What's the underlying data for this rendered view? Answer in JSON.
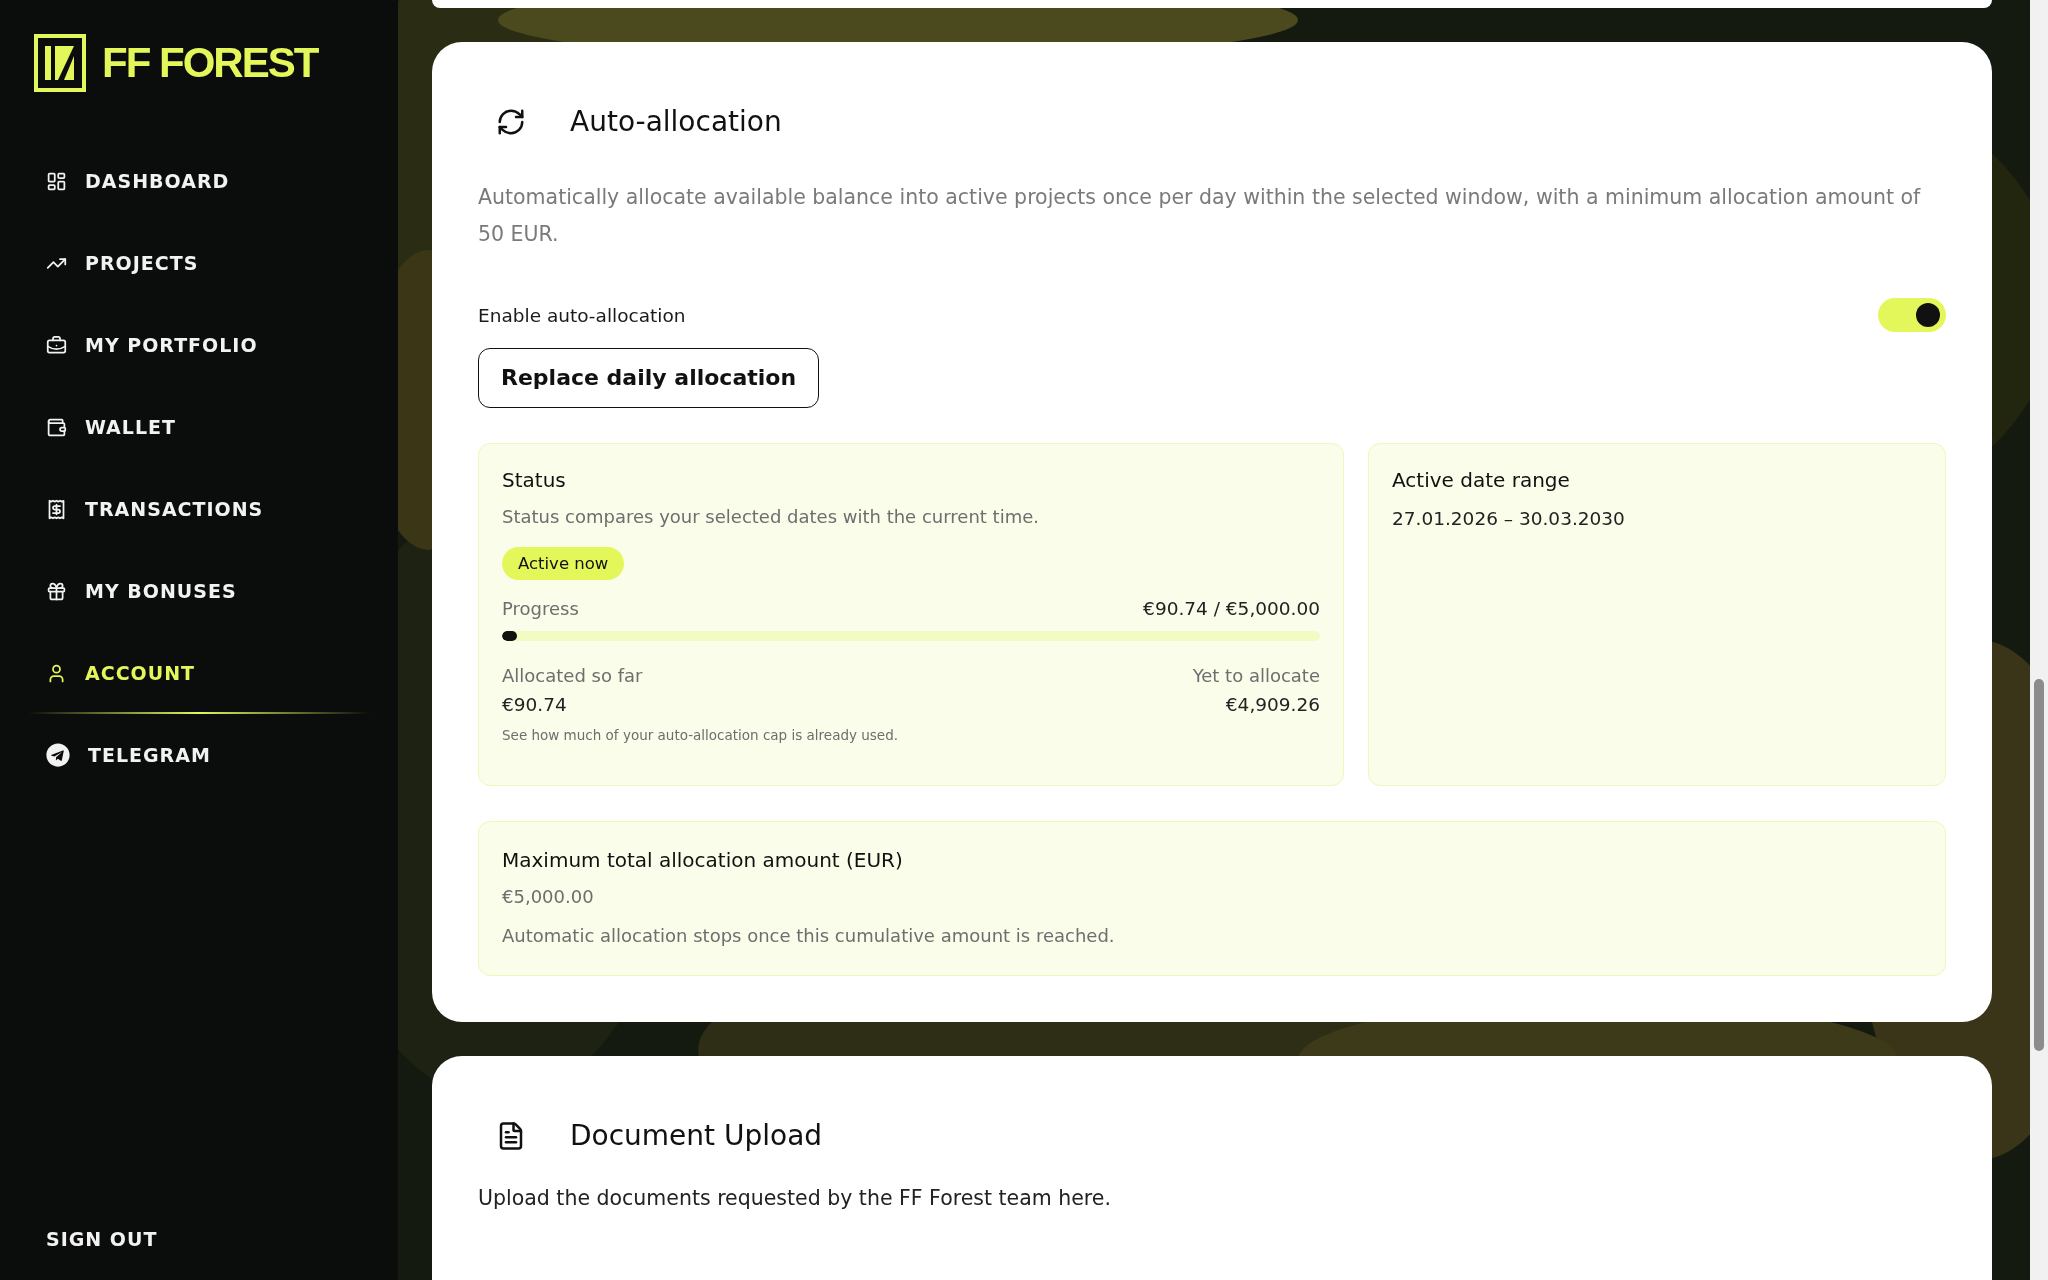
{
  "logo": {
    "text": "FF FOREST"
  },
  "nav": [
    {
      "label": "DASHBOARD",
      "kind": "dashboard",
      "selected": false
    },
    {
      "label": "PROJECTS",
      "kind": "projects",
      "selected": false
    },
    {
      "label": "MY PORTFOLIO",
      "kind": "portfolio",
      "selected": false
    },
    {
      "label": "WALLET",
      "kind": "wallet",
      "selected": false
    },
    {
      "label": "TRANSACTIONS",
      "kind": "transactions",
      "selected": false
    },
    {
      "label": "MY BONUSES",
      "kind": "bonuses",
      "selected": false
    },
    {
      "label": "ACCOUNT",
      "kind": "account",
      "selected": true
    },
    {
      "label": "TELEGRAM",
      "kind": "telegram",
      "selected": false
    }
  ],
  "sign_out": "SIGN OUT",
  "auto_allocation": {
    "title": "Auto-allocation",
    "description": "Automatically allocate available balance into active projects once per day within the selected window, with a minimum allocation amount of 50 EUR.",
    "enable": {
      "label": "Enable auto-allocation",
      "on": true
    },
    "replace_button": "Replace daily allocation",
    "status": {
      "title": "Status",
      "description": "Status compares your selected dates with the current time.",
      "badge": "Active now",
      "progress_label": "Progress",
      "progress_reading": "€90.74 / €5,000.00",
      "level": 0.018,
      "allocated_label": "Allocated so far",
      "allocated_value": "€90.74",
      "remaining_label": "Yet to allocate",
      "remaining_value": "€4,909.26",
      "note": "See how much of your auto-allocation cap is already used."
    },
    "date_range": {
      "title": "Active date range",
      "value": "27.01.2026 – 30.03.2030"
    },
    "maximum": {
      "title": "Maximum total allocation amount (EUR)",
      "value": "€5,000.00",
      "note": "Automatic allocation stops once this cumulative amount is reached."
    }
  },
  "document_upload": {
    "title": "Document Upload",
    "description": "Upload the documents requested by the FF Forest team here."
  }
}
